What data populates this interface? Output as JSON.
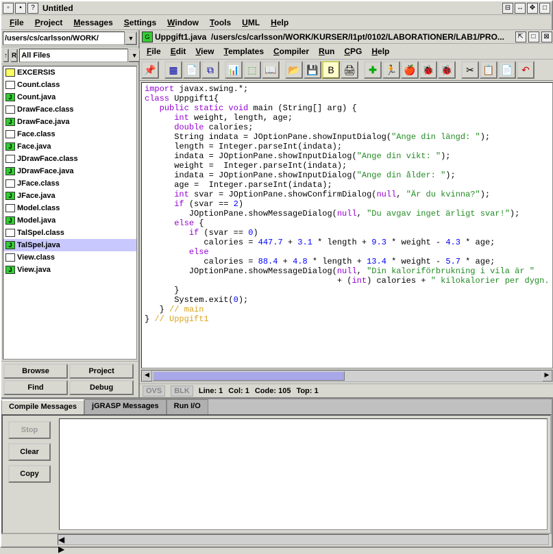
{
  "window": {
    "title": "Untitled"
  },
  "main_menu": [
    "File",
    "Project",
    "Messages",
    "Settings",
    "Window",
    "Tools",
    "UML",
    "Help"
  ],
  "path": "/users/cs/carlsson/WORK/",
  "filter_btn_up": "↑",
  "filter_btn_r": "R",
  "filter_select": "All Files",
  "files": [
    {
      "name": "EXCERSIS",
      "type": "folder"
    },
    {
      "name": "Count.class",
      "type": "doc"
    },
    {
      "name": "Count.java",
      "type": "java"
    },
    {
      "name": "DrawFace.class",
      "type": "doc"
    },
    {
      "name": "DrawFace.java",
      "type": "java"
    },
    {
      "name": "Face.class",
      "type": "doc"
    },
    {
      "name": "Face.java",
      "type": "java"
    },
    {
      "name": "JDrawFace.class",
      "type": "doc"
    },
    {
      "name": "JDrawFace.java",
      "type": "java"
    },
    {
      "name": "JFace.class",
      "type": "doc"
    },
    {
      "name": "JFace.java",
      "type": "java"
    },
    {
      "name": "Model.class",
      "type": "doc"
    },
    {
      "name": "Model.java",
      "type": "java"
    },
    {
      "name": "TalSpel.class",
      "type": "doc"
    },
    {
      "name": "TalSpel.java",
      "type": "java",
      "selected": true
    },
    {
      "name": "View.class",
      "type": "doc"
    },
    {
      "name": "View.java",
      "type": "java"
    }
  ],
  "left_buttons": {
    "browse": "Browse",
    "project": "Project",
    "find": "Find",
    "debug": "Debug"
  },
  "editor": {
    "file": "Uppgift1.java",
    "path": "/users/cs/carlsson/WORK/KURSER/I1pt/0102/LABORATIONER/LAB1/PRO...",
    "menu": [
      "File",
      "Edit",
      "View",
      "Templates",
      "Compiler",
      "Run",
      "CPG",
      "Help"
    ]
  },
  "status": {
    "ovs": "OVS",
    "blk": "BLK",
    "line": "Line: 1",
    "col": "Col: 1",
    "code": "Code: 105",
    "top": "Top: 1"
  },
  "tabs": {
    "compile": "Compile Messages",
    "jgrasp": "jGRASP Messages",
    "runio": "Run I/O"
  },
  "msg_buttons": {
    "stop": "Stop",
    "clear": "Clear",
    "copy": "Copy"
  },
  "code_lines": [
    [
      {
        "t": "import",
        "c": "kw"
      },
      {
        "t": " javax.swing.*;"
      }
    ],
    [
      {
        "t": "class",
        "c": "kw"
      },
      {
        "t": " Uppgift1{"
      }
    ],
    [
      {
        "t": "   "
      },
      {
        "t": "public static void",
        "c": "kw"
      },
      {
        "t": " main (String[] arg) {"
      }
    ],
    [
      {
        "t": "      "
      },
      {
        "t": "int",
        "c": "ty"
      },
      {
        "t": " weight, length, age;"
      }
    ],
    [
      {
        "t": "      "
      },
      {
        "t": "double",
        "c": "ty"
      },
      {
        "t": " calories;"
      }
    ],
    [
      {
        "t": "      String indata = JOptionPane.showInputDialog("
      },
      {
        "t": "\"Ange din längd: \"",
        "c": "str"
      },
      {
        "t": ");"
      }
    ],
    [
      {
        "t": "      length = Integer.parseInt(indata);"
      }
    ],
    [
      {
        "t": "      indata = JOptionPane.showInputDialog("
      },
      {
        "t": "\"Ange din vikt: \"",
        "c": "str"
      },
      {
        "t": ");"
      }
    ],
    [
      {
        "t": "      weight =  Integer.parseInt(indata);"
      }
    ],
    [
      {
        "t": "      indata = JOptionPane.showInputDialog("
      },
      {
        "t": "\"Ange din ålder: \"",
        "c": "str"
      },
      {
        "t": ");"
      }
    ],
    [
      {
        "t": "      age =  Integer.parseInt(indata);"
      }
    ],
    [
      {
        "t": "      "
      },
      {
        "t": "int",
        "c": "ty"
      },
      {
        "t": " svar = JOptionPane.showConfirmDialog("
      },
      {
        "t": "null",
        "c": "kw"
      },
      {
        "t": ", "
      },
      {
        "t": "\"Är du kvinna?\"",
        "c": "str"
      },
      {
        "t": ");"
      }
    ],
    [
      {
        "t": "      "
      },
      {
        "t": "if",
        "c": "kw"
      },
      {
        "t": " (svar == "
      },
      {
        "t": "2",
        "c": "num"
      },
      {
        "t": ")"
      }
    ],
    [
      {
        "t": "         JOptionPane.showMessageDialog("
      },
      {
        "t": "null",
        "c": "kw"
      },
      {
        "t": ", "
      },
      {
        "t": "\"Du avgav inget ärligt svar!\"",
        "c": "str"
      },
      {
        "t": ");"
      }
    ],
    [
      {
        "t": "      "
      },
      {
        "t": "else",
        "c": "kw"
      },
      {
        "t": " {"
      }
    ],
    [
      {
        "t": "         "
      },
      {
        "t": "if",
        "c": "kw"
      },
      {
        "t": " (svar == "
      },
      {
        "t": "0",
        "c": "num"
      },
      {
        "t": ")"
      }
    ],
    [
      {
        "t": "            calories = "
      },
      {
        "t": "447.7",
        "c": "num"
      },
      {
        "t": " + "
      },
      {
        "t": "3.1",
        "c": "num"
      },
      {
        "t": " * length + "
      },
      {
        "t": "9.3",
        "c": "num"
      },
      {
        "t": " * weight - "
      },
      {
        "t": "4.3",
        "c": "num"
      },
      {
        "t": " * age;"
      }
    ],
    [
      {
        "t": "         "
      },
      {
        "t": "else",
        "c": "kw"
      }
    ],
    [
      {
        "t": "            calories = "
      },
      {
        "t": "88.4",
        "c": "num"
      },
      {
        "t": " + "
      },
      {
        "t": "4.8",
        "c": "num"
      },
      {
        "t": " * length + "
      },
      {
        "t": "13.4",
        "c": "num"
      },
      {
        "t": " * weight - "
      },
      {
        "t": "5.7",
        "c": "num"
      },
      {
        "t": " * age;"
      }
    ],
    [
      {
        "t": "         JOptionPane.showMessageDialog("
      },
      {
        "t": "null",
        "c": "kw"
      },
      {
        "t": ", "
      },
      {
        "t": "\"Din kaloriförbrukning i vila är \"",
        "c": "str"
      }
    ],
    [
      {
        "t": "                                       + ("
      },
      {
        "t": "int",
        "c": "ty"
      },
      {
        "t": ") calories + "
      },
      {
        "t": "\" kilokalorier per dygn.",
        "c": "str"
      }
    ],
    [
      {
        "t": "      }"
      }
    ],
    [
      {
        "t": "      System.exit("
      },
      {
        "t": "0",
        "c": "num"
      },
      {
        "t": ");"
      }
    ],
    [
      {
        "t": "   } "
      },
      {
        "t": "// main",
        "c": "cmt"
      }
    ],
    [
      {
        "t": "} "
      },
      {
        "t": "// Uppgift1",
        "c": "cmt"
      }
    ]
  ]
}
